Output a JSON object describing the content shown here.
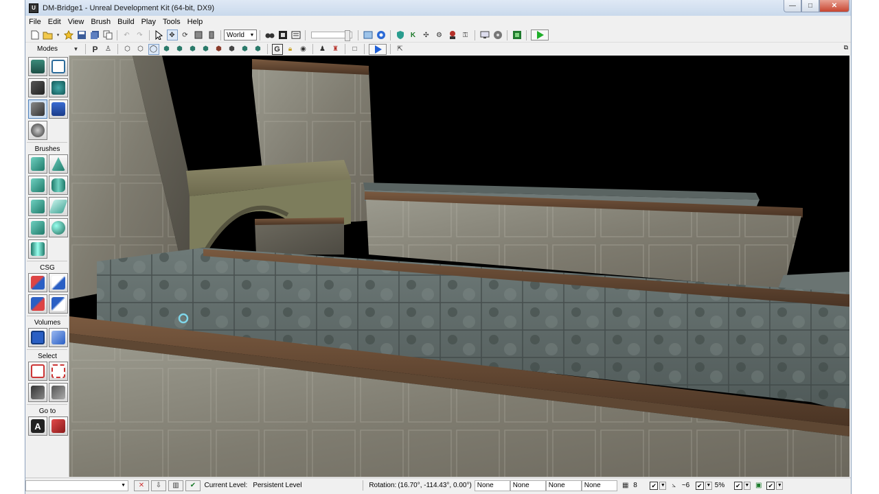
{
  "window": {
    "title": "DM-Bridge1 - Unreal Development Kit (64-bit, DX9)",
    "app_icon": "U",
    "minimize": "—",
    "maximize": "□",
    "close": "✕"
  },
  "menubar": {
    "items": [
      "File",
      "Edit",
      "View",
      "Brush",
      "Build",
      "Play",
      "Tools",
      "Help"
    ]
  },
  "toolbar1": {
    "coord_system": "World"
  },
  "toolbar2": {
    "modes_label": "Modes",
    "p_label": "P",
    "g_label": "G"
  },
  "left_panel": {
    "brushes_label": "Brushes",
    "csg_label": "CSG",
    "volumes_label": "Volumes",
    "select_label": "Select",
    "goto_label": "Go to",
    "goto_a_label": "A"
  },
  "statusbar": {
    "current_level_label": "Current Level:",
    "current_level_value": "Persistent Level",
    "rotation_label": "Rotation:",
    "rotation_value": "(16.70°, -114.43°, 0.00°)",
    "fields": [
      "None",
      "None",
      "None",
      "None"
    ],
    "grid_value": "8",
    "angle_value": "~6",
    "scale_value": "5%"
  },
  "colors": {
    "viewport_sky": "#000000",
    "play_green": "#1fae2a"
  }
}
